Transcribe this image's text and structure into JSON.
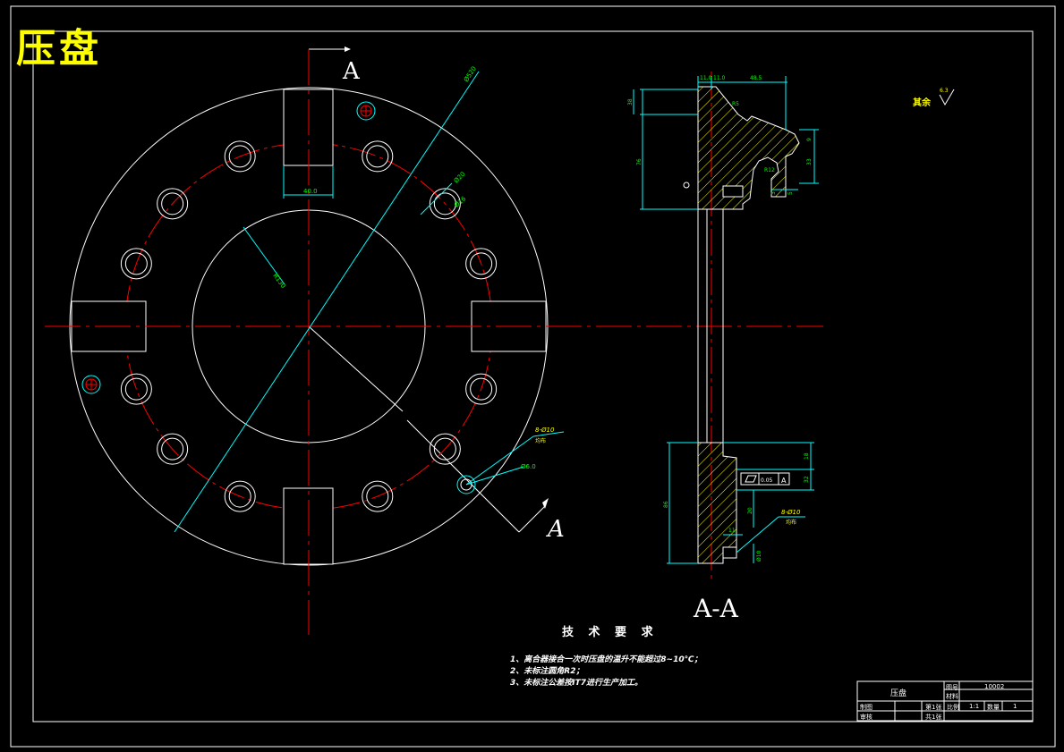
{
  "drawing": {
    "title": "压盘",
    "section_label": "A-A",
    "section_mark": "A",
    "roughness_note": "其余",
    "roughness_value": "6.3"
  },
  "front_view": {
    "dims": {
      "slot_width": "40.0",
      "hole_dia": "Ø20",
      "hole_dia2": "Ø16",
      "pitch_dia": "Ø410",
      "inner_radius": "R130",
      "outer_dia": "Ø520",
      "small_hole": "8-Ø10",
      "small_hole_note": "均布",
      "small_hole_depth": "Ø6.0"
    }
  },
  "section_view": {
    "dims": {
      "top_w1": "11.0",
      "top_w2": "11.0",
      "top_w3": "48.5",
      "h1": "38",
      "h2": "76",
      "r1": "R5",
      "r2": "R12",
      "v1": "9",
      "v2": "33",
      "v3": "3",
      "v4": "5",
      "bot_h1": "18",
      "bot_h2": "32",
      "bot_h3": "86",
      "bot_h4": "20",
      "bot_w": "11",
      "bot_dia": "Ø10",
      "bot_hole": "8-Ø10",
      "bot_hole_note": "均布",
      "tol_value": "0.05",
      "datum": "A"
    }
  },
  "tech_req": {
    "title": "技 术 要 求",
    "lines": [
      "1、离合器接合一次时压盘的温升不能超过8~10℃；",
      "2、未标注圆角R2；",
      "3、未标注公差按IT7进行生产加工。"
    ]
  },
  "title_block": {
    "part_name": "压盘",
    "drawing_no_label": "图号",
    "drawing_no": "10002",
    "material_label": "材料",
    "material": "",
    "drawn_label": "制图",
    "checked_label": "审核",
    "page_label": "第1张",
    "total_label": "共1张",
    "scale_label": "比例",
    "scale": "1:1",
    "qty_label": "数量",
    "qty": "1"
  },
  "colors": {
    "background": "#000000",
    "outline": "#ffffff",
    "center": "#ff0000",
    "dimension": "#00ffff",
    "text_accent": "#ffff00",
    "dim_text": "#00ff00"
  }
}
